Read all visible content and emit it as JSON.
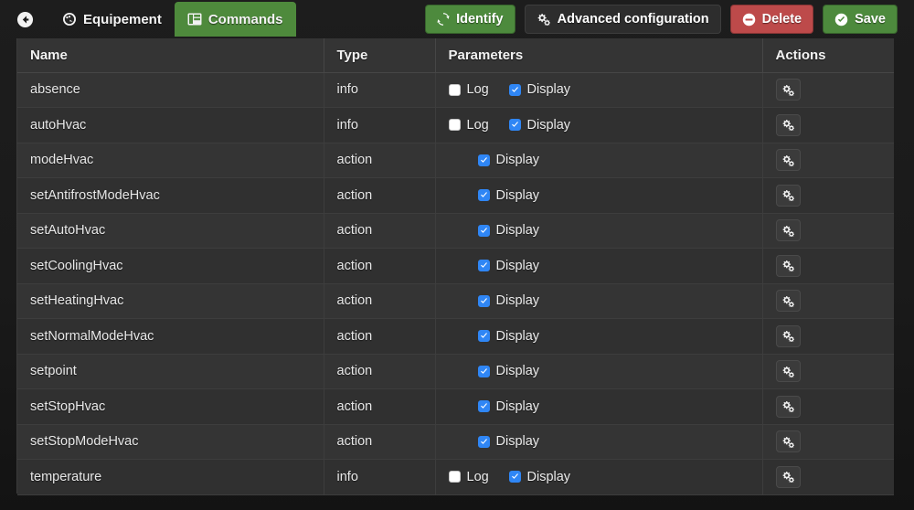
{
  "toolbar": {
    "back_icon": "arrow-circle-left-icon",
    "tabs": [
      {
        "label": "Equipement",
        "icon": "dashboard-icon",
        "active": false
      },
      {
        "label": "Commands",
        "icon": "list-alt-icon",
        "active": true
      }
    ],
    "buttons": [
      {
        "label": "Identify",
        "icon": "refresh-icon",
        "style": "green"
      },
      {
        "label": "Advanced configuration",
        "icon": "cogs-icon",
        "style": "dark"
      },
      {
        "label": "Delete",
        "icon": "minus-circle-icon",
        "style": "red"
      },
      {
        "label": "Save",
        "icon": "check-circle-icon",
        "style": "green"
      }
    ]
  },
  "colors": {
    "green": "#4d8a3d",
    "red": "#bd4a4a",
    "dark": "#2d2d2d",
    "checkbox_on": "#2f86f5",
    "table_bg": "#333333",
    "page_bg": "#191919"
  },
  "table": {
    "columns": [
      "Name",
      "Type",
      "Parameters",
      "Actions"
    ],
    "param_labels": {
      "log": "Log",
      "display": "Display"
    },
    "action_icon": "cogs-icon",
    "rows": [
      {
        "name": "absence",
        "type": "info",
        "has_log": true,
        "log": false,
        "display": true
      },
      {
        "name": "autoHvac",
        "type": "info",
        "has_log": true,
        "log": false,
        "display": true
      },
      {
        "name": "modeHvac",
        "type": "action",
        "has_log": false,
        "log": false,
        "display": true
      },
      {
        "name": "setAntifrostModeHvac",
        "type": "action",
        "has_log": false,
        "log": false,
        "display": true
      },
      {
        "name": "setAutoHvac",
        "type": "action",
        "has_log": false,
        "log": false,
        "display": true
      },
      {
        "name": "setCoolingHvac",
        "type": "action",
        "has_log": false,
        "log": false,
        "display": true
      },
      {
        "name": "setHeatingHvac",
        "type": "action",
        "has_log": false,
        "log": false,
        "display": true
      },
      {
        "name": "setNormalModeHvac",
        "type": "action",
        "has_log": false,
        "log": false,
        "display": true
      },
      {
        "name": "setpoint",
        "type": "action",
        "has_log": false,
        "log": false,
        "display": true
      },
      {
        "name": "setStopHvac",
        "type": "action",
        "has_log": false,
        "log": false,
        "display": true
      },
      {
        "name": "setStopModeHvac",
        "type": "action",
        "has_log": false,
        "log": false,
        "display": true
      },
      {
        "name": "temperature",
        "type": "info",
        "has_log": true,
        "log": false,
        "display": true
      }
    ]
  }
}
